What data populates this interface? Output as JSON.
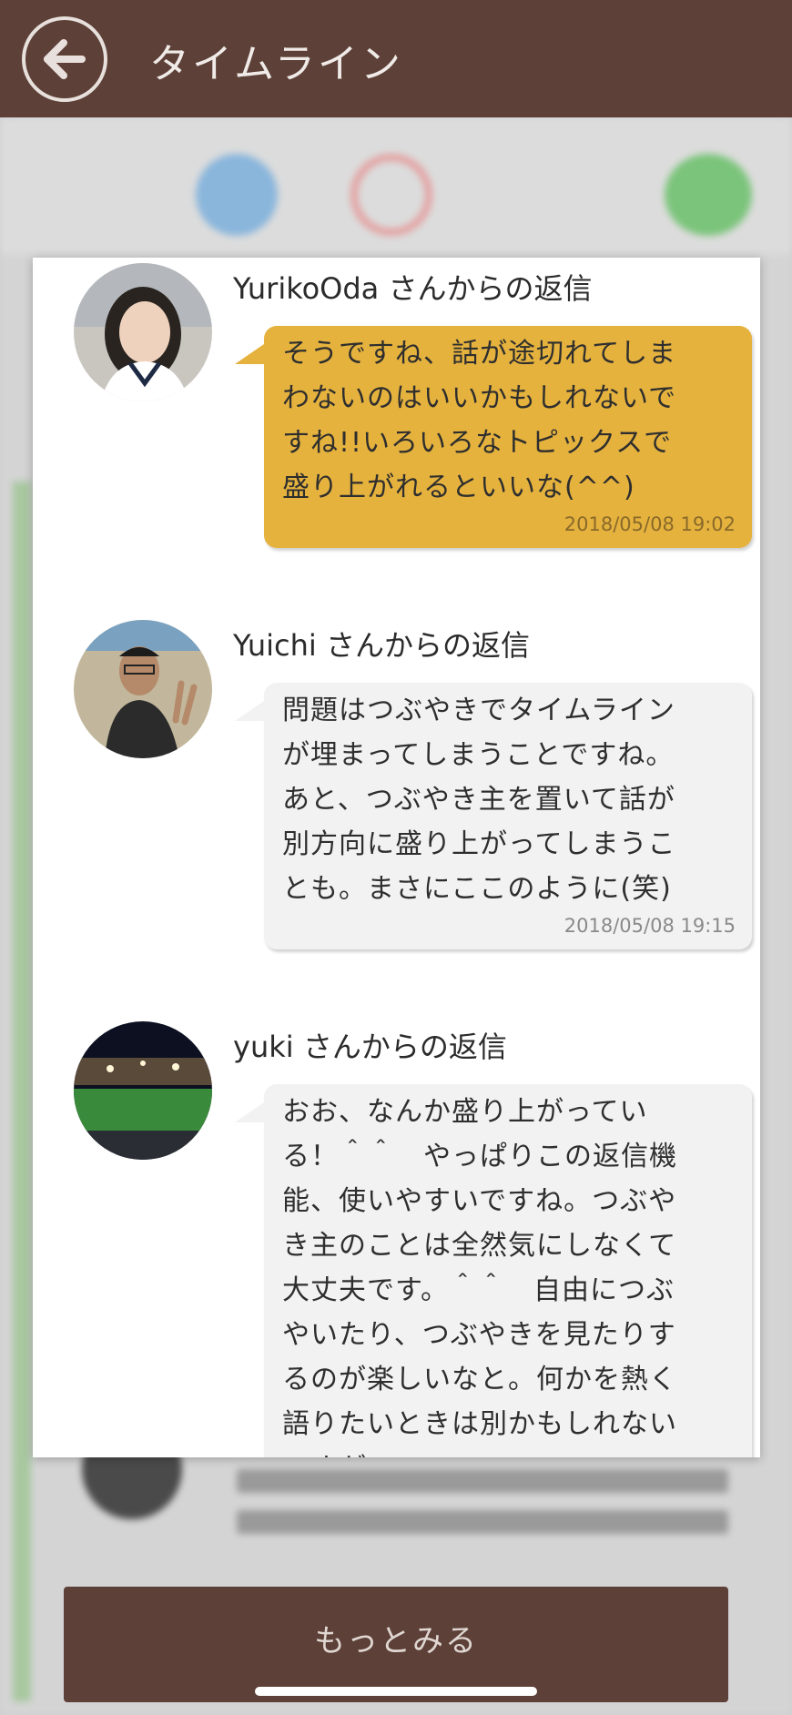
{
  "appbar": {
    "title": "タイムライン",
    "back_icon": "arrow-left-icon"
  },
  "replies": [
    {
      "name": "YurikoOda さんからの返信",
      "text": "そうですね、話が途切れてしま\nわないのはいいかもしれないで\nすね!!いろいろなトピックスで\n盛り上がれるといいな(^^)",
      "time": "2018/05/08 19:02",
      "bubble_color": "#e5b23e"
    },
    {
      "name": "Yuichi さんからの返信",
      "text": "問題はつぶやきでタイムライン\nが埋まってしまうことですね。\nあと、つぶやき主を置いて話が\n別方向に盛り上がってしまうこ\nとも。まさにここのように(笑)",
      "time": "2018/05/08 19:15",
      "bubble_color": "#f2f2f2"
    },
    {
      "name": "yuki さんからの返信",
      "text": "おお、なんか盛り上がってい\nる！＾＾　やっぱりこの返信機\n能、使いやすいですね。つぶや\nき主のことは全然気にしなくて\n大丈夫です。＾＾　自由につぶ\nやいたり、つぶやきを見たりす\nるのが楽しいなと。何かを熱く\n語りたいときは別かもしれない\nですが",
      "time": "",
      "bubble_color": "#f2f2f2"
    }
  ],
  "more_button": {
    "label": "もっとみる"
  },
  "colors": {
    "brand_brown": "#5d4037",
    "highlight_bubble": "#e5b23e",
    "default_bubble": "#f2f2f2"
  }
}
